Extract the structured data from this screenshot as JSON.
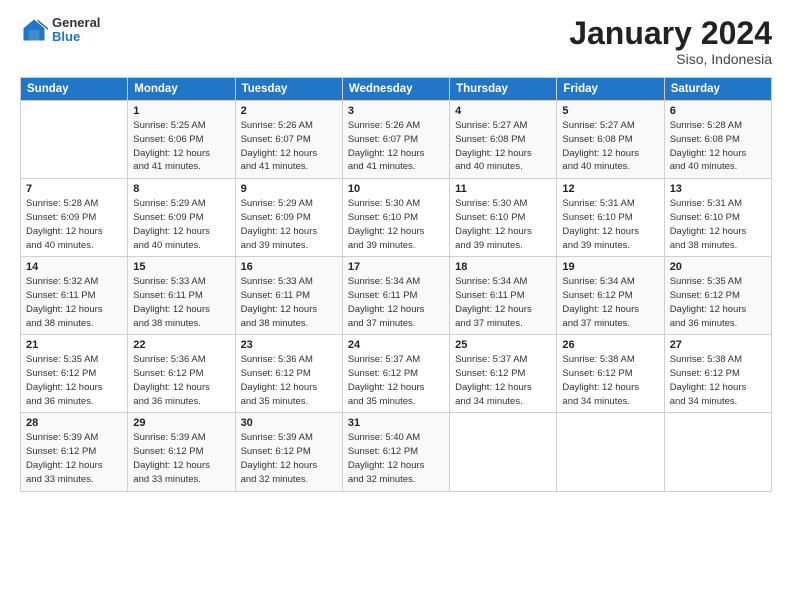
{
  "header": {
    "logo_general": "General",
    "logo_blue": "Blue",
    "title": "January 2024",
    "location": "Siso, Indonesia"
  },
  "weekdays": [
    "Sunday",
    "Monday",
    "Tuesday",
    "Wednesday",
    "Thursday",
    "Friday",
    "Saturday"
  ],
  "weeks": [
    [
      {
        "day": "",
        "info": ""
      },
      {
        "day": "1",
        "info": "Sunrise: 5:25 AM\nSunset: 6:06 PM\nDaylight: 12 hours\nand 41 minutes."
      },
      {
        "day": "2",
        "info": "Sunrise: 5:26 AM\nSunset: 6:07 PM\nDaylight: 12 hours\nand 41 minutes."
      },
      {
        "day": "3",
        "info": "Sunrise: 5:26 AM\nSunset: 6:07 PM\nDaylight: 12 hours\nand 41 minutes."
      },
      {
        "day": "4",
        "info": "Sunrise: 5:27 AM\nSunset: 6:08 PM\nDaylight: 12 hours\nand 40 minutes."
      },
      {
        "day": "5",
        "info": "Sunrise: 5:27 AM\nSunset: 6:08 PM\nDaylight: 12 hours\nand 40 minutes."
      },
      {
        "day": "6",
        "info": "Sunrise: 5:28 AM\nSunset: 6:08 PM\nDaylight: 12 hours\nand 40 minutes."
      }
    ],
    [
      {
        "day": "7",
        "info": "Sunrise: 5:28 AM\nSunset: 6:09 PM\nDaylight: 12 hours\nand 40 minutes."
      },
      {
        "day": "8",
        "info": "Sunrise: 5:29 AM\nSunset: 6:09 PM\nDaylight: 12 hours\nand 40 minutes."
      },
      {
        "day": "9",
        "info": "Sunrise: 5:29 AM\nSunset: 6:09 PM\nDaylight: 12 hours\nand 39 minutes."
      },
      {
        "day": "10",
        "info": "Sunrise: 5:30 AM\nSunset: 6:10 PM\nDaylight: 12 hours\nand 39 minutes."
      },
      {
        "day": "11",
        "info": "Sunrise: 5:30 AM\nSunset: 6:10 PM\nDaylight: 12 hours\nand 39 minutes."
      },
      {
        "day": "12",
        "info": "Sunrise: 5:31 AM\nSunset: 6:10 PM\nDaylight: 12 hours\nand 39 minutes."
      },
      {
        "day": "13",
        "info": "Sunrise: 5:31 AM\nSunset: 6:10 PM\nDaylight: 12 hours\nand 38 minutes."
      }
    ],
    [
      {
        "day": "14",
        "info": "Sunrise: 5:32 AM\nSunset: 6:11 PM\nDaylight: 12 hours\nand 38 minutes."
      },
      {
        "day": "15",
        "info": "Sunrise: 5:33 AM\nSunset: 6:11 PM\nDaylight: 12 hours\nand 38 minutes."
      },
      {
        "day": "16",
        "info": "Sunrise: 5:33 AM\nSunset: 6:11 PM\nDaylight: 12 hours\nand 38 minutes."
      },
      {
        "day": "17",
        "info": "Sunrise: 5:34 AM\nSunset: 6:11 PM\nDaylight: 12 hours\nand 37 minutes."
      },
      {
        "day": "18",
        "info": "Sunrise: 5:34 AM\nSunset: 6:11 PM\nDaylight: 12 hours\nand 37 minutes."
      },
      {
        "day": "19",
        "info": "Sunrise: 5:34 AM\nSunset: 6:12 PM\nDaylight: 12 hours\nand 37 minutes."
      },
      {
        "day": "20",
        "info": "Sunrise: 5:35 AM\nSunset: 6:12 PM\nDaylight: 12 hours\nand 36 minutes."
      }
    ],
    [
      {
        "day": "21",
        "info": "Sunrise: 5:35 AM\nSunset: 6:12 PM\nDaylight: 12 hours\nand 36 minutes."
      },
      {
        "day": "22",
        "info": "Sunrise: 5:36 AM\nSunset: 6:12 PM\nDaylight: 12 hours\nand 36 minutes."
      },
      {
        "day": "23",
        "info": "Sunrise: 5:36 AM\nSunset: 6:12 PM\nDaylight: 12 hours\nand 35 minutes."
      },
      {
        "day": "24",
        "info": "Sunrise: 5:37 AM\nSunset: 6:12 PM\nDaylight: 12 hours\nand 35 minutes."
      },
      {
        "day": "25",
        "info": "Sunrise: 5:37 AM\nSunset: 6:12 PM\nDaylight: 12 hours\nand 34 minutes."
      },
      {
        "day": "26",
        "info": "Sunrise: 5:38 AM\nSunset: 6:12 PM\nDaylight: 12 hours\nand 34 minutes."
      },
      {
        "day": "27",
        "info": "Sunrise: 5:38 AM\nSunset: 6:12 PM\nDaylight: 12 hours\nand 34 minutes."
      }
    ],
    [
      {
        "day": "28",
        "info": "Sunrise: 5:39 AM\nSunset: 6:12 PM\nDaylight: 12 hours\nand 33 minutes."
      },
      {
        "day": "29",
        "info": "Sunrise: 5:39 AM\nSunset: 6:12 PM\nDaylight: 12 hours\nand 33 minutes."
      },
      {
        "day": "30",
        "info": "Sunrise: 5:39 AM\nSunset: 6:12 PM\nDaylight: 12 hours\nand 32 minutes."
      },
      {
        "day": "31",
        "info": "Sunrise: 5:40 AM\nSunset: 6:12 PM\nDaylight: 12 hours\nand 32 minutes."
      },
      {
        "day": "",
        "info": ""
      },
      {
        "day": "",
        "info": ""
      },
      {
        "day": "",
        "info": ""
      }
    ]
  ]
}
